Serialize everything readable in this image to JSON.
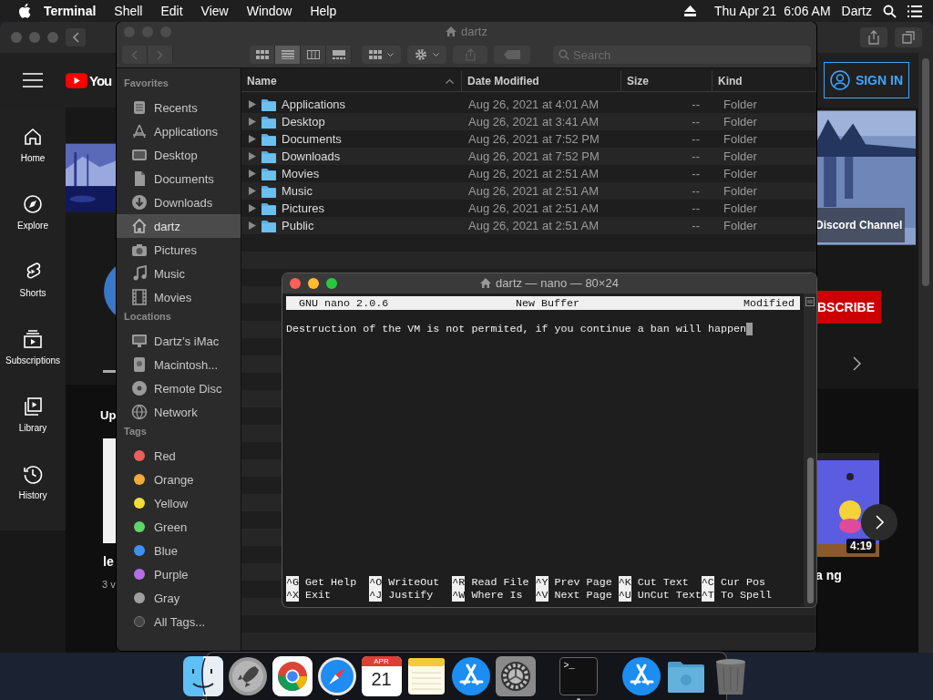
{
  "menu_bar": {
    "app_name": "Terminal",
    "menus": [
      "Shell",
      "Edit",
      "View",
      "Window",
      "Help"
    ],
    "clock": "Thu Apr 21  6:06 AM",
    "user": "Dartz"
  },
  "browser": {
    "logo_text": "You",
    "sign_in": "SIGN IN",
    "sidebar": [
      {
        "kind": "home",
        "label": "Home"
      },
      {
        "kind": "explore",
        "label": "Explore"
      },
      {
        "kind": "shorts",
        "label": "Shorts"
      },
      {
        "kind": "subscriptions",
        "label": "Subscriptions"
      },
      {
        "kind": "library",
        "label": "Library"
      },
      {
        "kind": "history",
        "label": "History"
      }
    ],
    "banner_caption": "Discord Channel",
    "subscribe": "BSCRIBE",
    "section_heading": "Up",
    "left_video_title": "le",
    "left_video_meta": "3 v",
    "right_video_title": "a ng",
    "right_video_duration": "4:19"
  },
  "finder": {
    "title": "dartz",
    "view_modes": [
      {
        "kind": "icons",
        "selected": false
      },
      {
        "kind": "list",
        "selected": true
      },
      {
        "kind": "columns",
        "selected": false
      },
      {
        "kind": "gallery",
        "selected": false
      }
    ],
    "search": {
      "placeholder": "Search"
    },
    "sidebar": [
      {
        "heading": "Favorites",
        "items": [
          {
            "kind": "recents",
            "label": "Recents",
            "selected": false
          },
          {
            "kind": "applications",
            "label": "Applications",
            "selected": false
          },
          {
            "kind": "desktop",
            "label": "Desktop",
            "selected": false
          },
          {
            "kind": "documents",
            "label": "Documents",
            "selected": false
          },
          {
            "kind": "downloads",
            "label": "Downloads",
            "selected": false
          },
          {
            "kind": "home",
            "label": "dartz",
            "selected": true
          },
          {
            "kind": "pictures",
            "label": "Pictures",
            "selected": false
          },
          {
            "kind": "music",
            "label": "Music",
            "selected": false
          },
          {
            "kind": "movies",
            "label": "Movies",
            "selected": false
          }
        ]
      },
      {
        "heading": "Locations",
        "items": [
          {
            "kind": "computer",
            "label": "Dartz’s iMac",
            "selected": false
          },
          {
            "kind": "disk",
            "label": "Macintosh...",
            "selected": false
          },
          {
            "kind": "disc",
            "label": "Remote Disc",
            "selected": false
          },
          {
            "kind": "network",
            "label": "Network",
            "selected": false
          }
        ]
      },
      {
        "heading": "Tags",
        "items": [
          {
            "kind": "tag",
            "label": "Red",
            "color": "#ec5f5d",
            "selected": false
          },
          {
            "kind": "tag",
            "label": "Orange",
            "color": "#f4a93b",
            "selected": false
          },
          {
            "kind": "tag",
            "label": "Yellow",
            "color": "#f3dc3a",
            "selected": false
          },
          {
            "kind": "tag",
            "label": "Green",
            "color": "#5dd764",
            "selected": false
          },
          {
            "kind": "tag",
            "label": "Blue",
            "color": "#3e90f3",
            "selected": false
          },
          {
            "kind": "tag",
            "label": "Purple",
            "color": "#b76ee8",
            "selected": false
          },
          {
            "kind": "tag",
            "label": "Gray",
            "color": "#a0a0a0",
            "selected": false
          },
          {
            "kind": "all-tags",
            "label": "All Tags...",
            "selected": false
          }
        ]
      }
    ],
    "table": {
      "columns": [
        {
          "label": "Name",
          "sorted": true
        },
        {
          "label": "Date Modified",
          "sorted": false
        },
        {
          "label": "Size",
          "sorted": false
        },
        {
          "label": "Kind",
          "sorted": false
        }
      ],
      "rows": [
        {
          "name": "Applications",
          "date": "Aug 26, 2021 at 4:01 AM",
          "size": "--",
          "kind": "Folder"
        },
        {
          "name": "Desktop",
          "date": "Aug 26, 2021 at 3:41 AM",
          "size": "--",
          "kind": "Folder"
        },
        {
          "name": "Documents",
          "date": "Aug 26, 2021 at 7:52 PM",
          "size": "--",
          "kind": "Folder"
        },
        {
          "name": "Downloads",
          "date": "Aug 26, 2021 at 7:52 PM",
          "size": "--",
          "kind": "Folder"
        },
        {
          "name": "Movies",
          "date": "Aug 26, 2021 at 2:51 AM",
          "size": "--",
          "kind": "Folder"
        },
        {
          "name": "Music",
          "date": "Aug 26, 2021 at 2:51 AM",
          "size": "--",
          "kind": "Folder"
        },
        {
          "name": "Pictures",
          "date": "Aug 26, 2021 at 2:51 AM",
          "size": "--",
          "kind": "Folder"
        },
        {
          "name": "Public",
          "date": "Aug 26, 2021 at 2:51 AM",
          "size": "--",
          "kind": "Folder"
        }
      ]
    }
  },
  "terminal": {
    "title": "dartz — nano — 80×24",
    "header": {
      "version": "GNU nano 2.0.6",
      "buffer": "New Buffer",
      "status": "Modified"
    },
    "text": "Destruction of the VM is not permited, if you continue a ban will happen",
    "shortcut_rows": [
      [
        {
          "key": "^G",
          "label": "Get Help"
        },
        {
          "key": "^O",
          "label": "WriteOut"
        },
        {
          "key": "^R",
          "label": "Read File"
        },
        {
          "key": "^Y",
          "label": "Prev Page"
        },
        {
          "key": "^K",
          "label": "Cut Text"
        },
        {
          "key": "^C",
          "label": "Cur Pos"
        }
      ],
      [
        {
          "key": "^X",
          "label": "Exit"
        },
        {
          "key": "^J",
          "label": "Justify"
        },
        {
          "key": "^W",
          "label": "Where Is"
        },
        {
          "key": "^V",
          "label": "Next Page"
        },
        {
          "key": "^U",
          "label": "UnCut Text"
        },
        {
          "key": "^T",
          "label": "To Spell"
        }
      ]
    ]
  },
  "dock": {
    "items": [
      {
        "kind": "finder",
        "running": true
      },
      {
        "kind": "launchpad",
        "running": false
      },
      {
        "kind": "chrome",
        "running": false
      },
      {
        "kind": "safari",
        "running": true
      },
      {
        "kind": "calendar",
        "running": false,
        "month": "APR",
        "day": "21"
      },
      {
        "kind": "notes",
        "running": false
      },
      {
        "kind": "app-store",
        "running": false
      },
      {
        "kind": "settings",
        "running": false
      },
      {
        "kind": "separator"
      },
      {
        "kind": "terminal",
        "running": true,
        "prompt": ">_"
      },
      {
        "kind": "separator"
      },
      {
        "kind": "app-store",
        "running": false
      },
      {
        "kind": "folder",
        "running": false
      },
      {
        "kind": "trash",
        "running": false
      }
    ]
  }
}
